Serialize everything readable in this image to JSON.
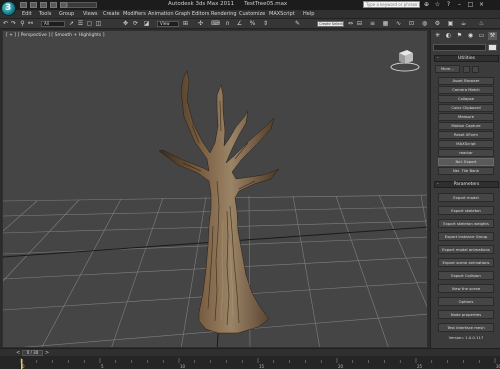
{
  "title_bar": {
    "app_title": "Autodesk 3ds Max 2011",
    "file_name": "TestTree05.max",
    "workspace_label": "Workspace",
    "search_placeholder": "Type a keyword or phrase",
    "app_logo_letter": "3"
  },
  "menu": [
    "Edit",
    "Tools",
    "Group",
    "Views",
    "Create",
    "Modifiers",
    "Animation",
    "Graph Editors",
    "Rendering",
    "Customize",
    "MAXScript",
    "Help"
  ],
  "toolbar": {
    "selection_filter": "All",
    "reference_coord": "View",
    "named_selection": "Create Selection Set"
  },
  "viewport": {
    "label": "[ + ] [ Perspective ] [ Smooth + Highlights ]",
    "colors": {
      "background": "#454545",
      "grid": "#8a8a8a",
      "bark_dark": "#3a2a1c",
      "bark_mid": "#6a5038",
      "bark_light": "#9b8466"
    }
  },
  "command_panel": {
    "utilities_title": "Utilities",
    "more_label": "More...",
    "utility_buttons": [
      "Asset Browser",
      "Camera Match",
      "Collapse",
      "Color Clipboard",
      "Measure",
      "Motion Capture",
      "Reset XForm",
      "MAXScript",
      "reactor",
      "Nel. Export",
      "Nel. Tile Bank"
    ],
    "active_utility": "Nel. Export",
    "parameters_title": "Parameters",
    "parameter_buttons": [
      "Export model",
      "Export skeleton",
      "Export skeleton weights",
      "Export Instance Group",
      "Export model animations",
      "Export scene animations",
      "Export Collision",
      "View the scene",
      "Options",
      "Node properties",
      "Test interface mesh"
    ],
    "version": "Version: 1.0.0.117"
  },
  "timeline": {
    "frame_readout": "0 / 30",
    "frame_current": 0,
    "frame_total": 30,
    "prev_symbol": "<",
    "next_symbol": ">",
    "ruler_labels": [
      "0",
      "5",
      "10",
      "15",
      "20",
      "25",
      "30"
    ]
  }
}
